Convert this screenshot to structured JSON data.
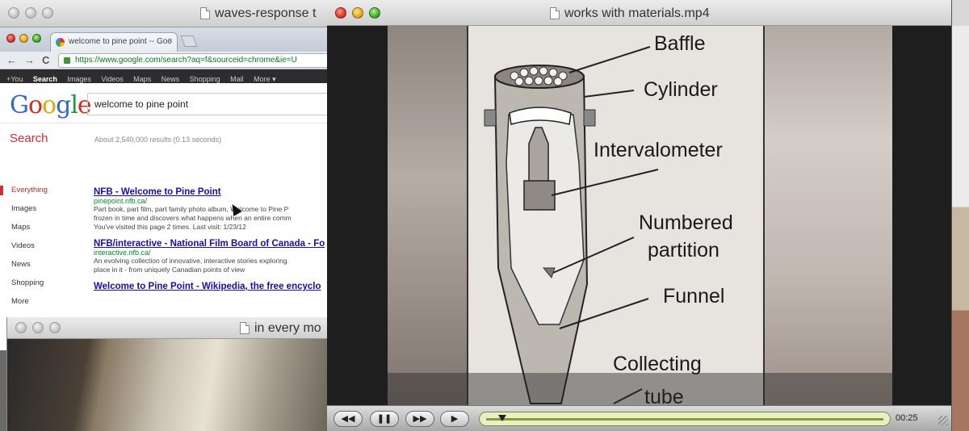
{
  "windows": {
    "waves": {
      "title": "waves-response t"
    },
    "browser": {
      "tab_title": "welcome to pine point -- Goo",
      "tab_close": "×",
      "back": "←",
      "forward": "→",
      "reload": "C",
      "url": "https://www.google.com/search?aq=f&sourceid=chrome&ie=U",
      "google_bar": [
        "+You",
        "Search",
        "Images",
        "Videos",
        "Maps",
        "News",
        "Shopping",
        "Mail",
        "More ▾"
      ],
      "query": "welcome to pine point",
      "search_label": "Search",
      "stats": "About 2,540,000 results (0.13 seconds)",
      "sidebar": [
        "Everything",
        "Images",
        "Maps",
        "Videos",
        "News",
        "Shopping",
        "More"
      ],
      "results": [
        {
          "title": "NFB - Welcome to Pine Point",
          "url": "pinepoint.nfb.ca/",
          "snippet": [
            "Part book, part film, part family photo album, Welcome to Pine P",
            "frozen in time and discovers what happens when an entire comm",
            "You've visited this page 2 times. Last visit: 1/23/12"
          ]
        },
        {
          "title": "NFB/interactive - National Film Board of Canada - Fo",
          "url": "interactive.nfb.ca/",
          "snippet": [
            "An evolving collection of innovative, interactive stories exploring",
            "place in it - from uniquely Canadian points of view"
          ]
        },
        {
          "title": "Welcome to Pine Point - Wikipedia, the free encyclo",
          "url": "",
          "snippet": []
        }
      ]
    },
    "mom": {
      "title": "in every mo"
    },
    "player": {
      "title": "works with materials.mp4",
      "labels": {
        "baffle": "Baffle",
        "cylinder": "Cylinder",
        "intervalometer": "Intervalometer",
        "numbered_1": "Numbered",
        "numbered_2": "partition",
        "funnel": "Funnel",
        "collecting_1": "Collecting",
        "collecting_2": "tube"
      },
      "controls": {
        "rewind": "◀◀",
        "pause": "❚❚",
        "fast_forward": "▶▶",
        "present": "▶",
        "time": "00:25"
      },
      "progress": 0.04
    }
  },
  "colors": {
    "google_blue": "#3366cc",
    "google_red": "#d52b1e",
    "link": "#1a0dab",
    "url_green": "#0a8a2a",
    "scrubber": "#e8eec6"
  }
}
